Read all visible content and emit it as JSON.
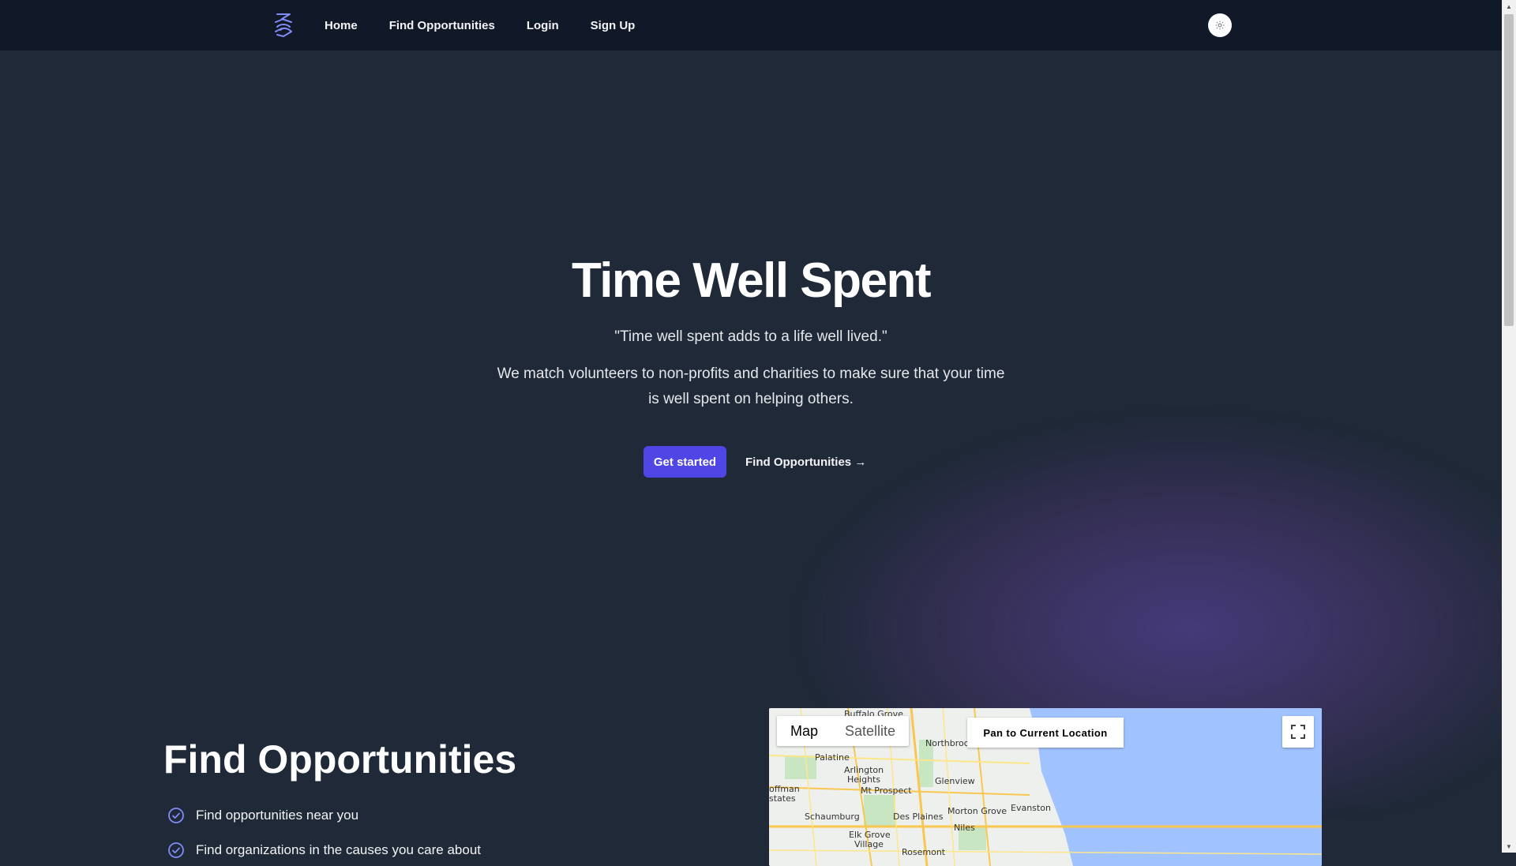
{
  "nav": {
    "links": [
      "Home",
      "Find Opportunities",
      "Login",
      "Sign Up"
    ]
  },
  "hero": {
    "title": "Time Well Spent",
    "quote": "\"Time well spent adds to a life well lived.\"",
    "description": "We match volunteers to non-profits and charities to make sure that your time is well spent on helping others.",
    "primary_button": "Get started",
    "secondary_link": "Find Opportunities →"
  },
  "section": {
    "title": "Find Opportunities",
    "features": [
      "Find opportunities near you",
      "Find organizations in the causes you care about"
    ]
  },
  "map": {
    "tabs": [
      "Map",
      "Satellite"
    ],
    "selected_tab": "Map",
    "pan_button": "Pan to Current Location",
    "labels": [
      {
        "text": "Buffalo Grove"
      },
      {
        "text": "Northbrook"
      },
      {
        "text": "Palatine"
      },
      {
        "text": "Arlington"
      },
      {
        "text": "Heights"
      },
      {
        "text": "Mt Prospect"
      },
      {
        "text": "Glenview"
      },
      {
        "text": "offman"
      },
      {
        "text": "states"
      },
      {
        "text": "Morton Grove"
      },
      {
        "text": "Evanston"
      },
      {
        "text": "Schaumburg"
      },
      {
        "text": "Des Plaines"
      },
      {
        "text": "Niles"
      },
      {
        "text": "Elk Grove"
      },
      {
        "text": "Village"
      },
      {
        "text": "Rosemont"
      }
    ],
    "colors": {
      "lake": "#a0c3ff",
      "land": "#eef0ee",
      "park": "#c8e6c1",
      "road": "#f9c74f"
    }
  },
  "colors": {
    "background": "#1f2937",
    "navbar": "#111827",
    "accent": "#4f46e5",
    "check": "#818cf8"
  }
}
